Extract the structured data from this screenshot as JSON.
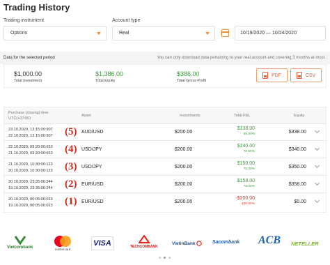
{
  "page_title": "Trading History",
  "filters": {
    "instrument_label": "Trading instrument",
    "instrument_value": "Options",
    "account_label": "Account type",
    "account_value": "Real",
    "date_range": "10/19/2020 — 10/24/2020"
  },
  "summary": {
    "header_left": "Data for the selected period",
    "header_right": "You can only download data pertaining to your real account and covering 3 months at most.",
    "total_investment_value": "$1,000.00",
    "total_investment_label": "Total Investment",
    "total_equity_value": "$1,386.00",
    "total_equity_label": "Total Equity",
    "gross_profit_value": "$386.00",
    "gross_profit_label": "Total Gross Profit",
    "pdf_label": "PDF",
    "csv_label": "CSV"
  },
  "table": {
    "headers": {
      "purchase": "Purchase (closing) time",
      "timezone": "UTC(+07:00)",
      "asset": "Asset",
      "investments": "Investments",
      "pnl": "Total P&L",
      "equity": "Equity"
    },
    "rows": [
      {
        "time1": "23.10.2020, 13:15:00:907",
        "time2": "22.10.2020, 13:15:00:907",
        "marker": "(5)",
        "asset": "AUD/USD",
        "investment": "$200.00",
        "pnl": "$138.00",
        "pct": "69.00%",
        "direction": "pos",
        "equity": "$338.00"
      },
      {
        "time1": "22.10.2020, 09:20:00:653",
        "time2": "21.10.2020, 09:20:00:653",
        "marker": "(4)",
        "asset": "USD/JPY",
        "investment": "$200.00",
        "pnl": "$140.00",
        "pct": "70.00%",
        "direction": "pos",
        "equity": "$340.00"
      },
      {
        "time1": "21.10.2020, 10:30:00:123",
        "time2": "20.10.2020, 10:30:00:123",
        "marker": "(3)",
        "asset": "USD/JPY",
        "investment": "$200.00",
        "pnl": "$150.00",
        "pct": "75.00%",
        "direction": "pos",
        "equity": "$350.00"
      },
      {
        "time1": "20.10.2020, 23:35:00:244",
        "time2": "19.10.2020, 23:35:00:244",
        "marker": "(2)",
        "asset": "EUR/USD",
        "investment": "$200.00",
        "pnl": "$158.00",
        "pct": "79.00%",
        "direction": "pos",
        "equity": "$358.00"
      },
      {
        "time1": "20.10.2020, 00:05:00:023",
        "time2": "19.10.2020, 00:05:00:023",
        "marker": "(1)",
        "asset": "EUR/USD",
        "investment": "$200.00",
        "pnl": "-$200.00",
        "pct": "-100.00%",
        "direction": "neg",
        "equity": "$0.00"
      }
    ]
  },
  "logos": {
    "vietcombank": "Vietcombank",
    "mastercard": "mastercard",
    "visa": "VISA",
    "techcombank": "TECHCOMBANK",
    "vietinbank": "VietinBank",
    "sacombank": "Sacombank",
    "acb": "ACB",
    "neteller": "NETELLER"
  },
  "colors": {
    "accent_orange": "#e8923a",
    "profit_green": "#3a9a3a",
    "loss_red": "#d4341f",
    "marker_red": "#cc2b1d"
  }
}
